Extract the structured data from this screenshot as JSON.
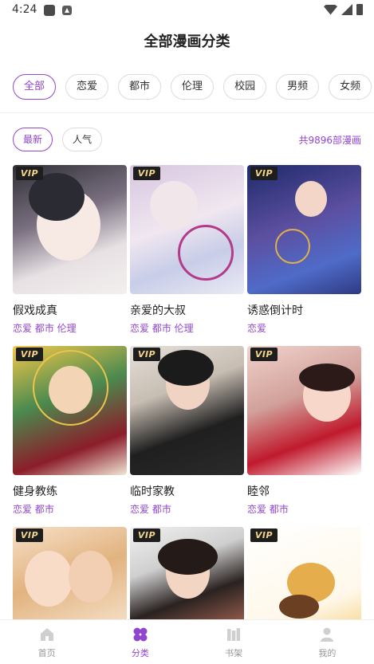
{
  "status_bar": {
    "time": "4:24"
  },
  "page_title": "全部漫画分类",
  "categories": [
    "全部",
    "恋爱",
    "都市",
    "伦理",
    "校园",
    "男频",
    "女频"
  ],
  "sort": {
    "options": [
      "最新",
      "人气"
    ],
    "total": "共9896部漫画"
  },
  "comics": [
    {
      "title": "假戏成真",
      "tags": "恋爱 都市 伦理",
      "badge": "VIP"
    },
    {
      "title": "亲爱的大叔",
      "tags": "恋爱 都市 伦理",
      "badge": "VIP"
    },
    {
      "title": "诱惑倒计时",
      "tags": "恋爱",
      "badge": "VIP"
    },
    {
      "title": "健身教练",
      "tags": "恋爱 都市",
      "badge": "VIP"
    },
    {
      "title": "临时家教",
      "tags": "恋爱 都市",
      "badge": "VIP"
    },
    {
      "title": "睦邻",
      "tags": "恋爱 都市",
      "badge": "VIP"
    },
    {
      "title": "",
      "tags": "",
      "badge": "VIP"
    },
    {
      "title": "",
      "tags": "",
      "badge": "VIP"
    },
    {
      "title": "",
      "tags": "",
      "badge": "VIP"
    }
  ],
  "nav": [
    {
      "label": "首页",
      "icon": "home-icon"
    },
    {
      "label": "分类",
      "icon": "category-icon"
    },
    {
      "label": "书架",
      "icon": "bookshelf-icon"
    },
    {
      "label": "我的",
      "icon": "profile-icon"
    }
  ],
  "colors": {
    "accent": "#9146d0",
    "vip_badge_bg": "#1e1e1e",
    "vip_badge_text": "#f1d38a"
  }
}
